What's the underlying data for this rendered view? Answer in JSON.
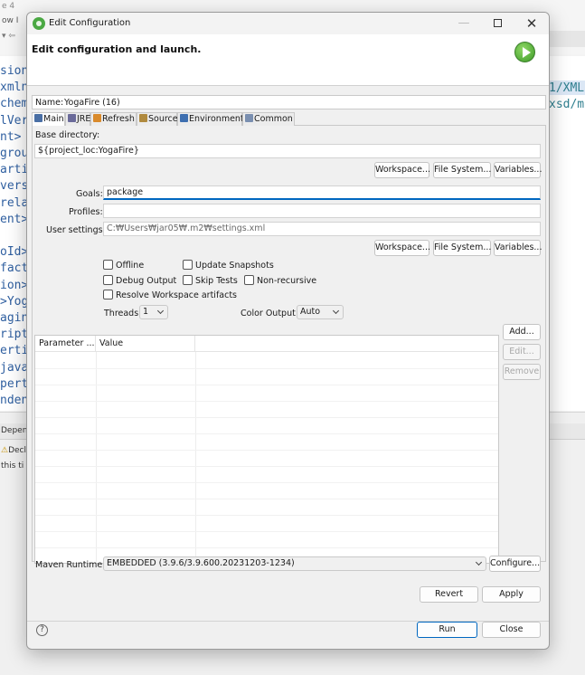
{
  "background": {
    "top_lines": [
      "e 4",
      "ow  I",
      "▾ ⇦"
    ],
    "editor_lines": [
      "sion",
      "xmln",
      "chem",
      "lVer",
      "nt>",
      "grou",
      "arti",
      "vers",
      "rela",
      "ent>",
      "",
      "oId>",
      "fact",
      "ion>",
      ">Yog",
      "agin",
      "ript",
      "erti",
      "java",
      "pert",
      "nden"
    ],
    "editor_right_lines": [
      "1/XML",
      "xsd/m"
    ],
    "bottom_tab": "Depen",
    "bottom_row1": "Decla",
    "bottom_row2": "this ti"
  },
  "window": {
    "title": "Edit Configuration",
    "minimize": "—",
    "close": "✕"
  },
  "header": {
    "title": "Edit configuration and launch."
  },
  "name": {
    "label": "Name:",
    "value": "YogaFire (16)"
  },
  "tabs": [
    {
      "label": "Main",
      "icon": "main-tab-icon",
      "color": "#4a6fa5"
    },
    {
      "label": "JRE",
      "icon": "jre-icon",
      "color": "#6b6b9a"
    },
    {
      "label": "Refresh",
      "icon": "refresh-icon",
      "color": "#d98a2b"
    },
    {
      "label": "Source",
      "icon": "source-icon",
      "color": "#b08a3e"
    },
    {
      "label": "Environment",
      "icon": "environment-icon",
      "color": "#3e6fb0"
    },
    {
      "label": "Common",
      "icon": "common-icon",
      "color": "#7a8fb0"
    }
  ],
  "main": {
    "base_directory": {
      "label": "Base directory:",
      "value": "${project_loc:YogaFire}",
      "workspace": "Workspace...",
      "file_system": "File System...",
      "variables": "Variables..."
    },
    "goals": {
      "label": "Goals:",
      "value": "package"
    },
    "profiles": {
      "label": "Profiles:",
      "value": ""
    },
    "user_settings": {
      "label": "User settings:",
      "value": "C:₩Users₩jar05₩.m2₩settings.xml",
      "workspace": "Workspace...",
      "file_system": "File System...",
      "variables": "Variables..."
    },
    "options": {
      "offline": "Offline",
      "update_snapshots": "Update Snapshots",
      "debug_output": "Debug Output",
      "skip_tests": "Skip Tests",
      "non_recursive": "Non-recursive",
      "resolve_workspace": "Resolve Workspace artifacts"
    },
    "threads": {
      "label": "Threads:",
      "value": "1"
    },
    "color_output": {
      "label": "Color Output:",
      "value": "Auto"
    },
    "parameters": {
      "columns": [
        "Parameter ...",
        "Value"
      ],
      "add": "Add...",
      "edit": "Edit...",
      "remove": "Remove"
    },
    "maven_runtime": {
      "label": "Maven Runtime:",
      "value": "EMBEDDED (3.9.6/3.9.600.20231203-1234)",
      "configure": "Configure..."
    }
  },
  "actions": {
    "revert": "Revert",
    "apply": "Apply",
    "run": "Run",
    "close": "Close",
    "help": "?"
  },
  "colors": {
    "accent": "#0067c0",
    "run_green": "#3d9a27"
  }
}
